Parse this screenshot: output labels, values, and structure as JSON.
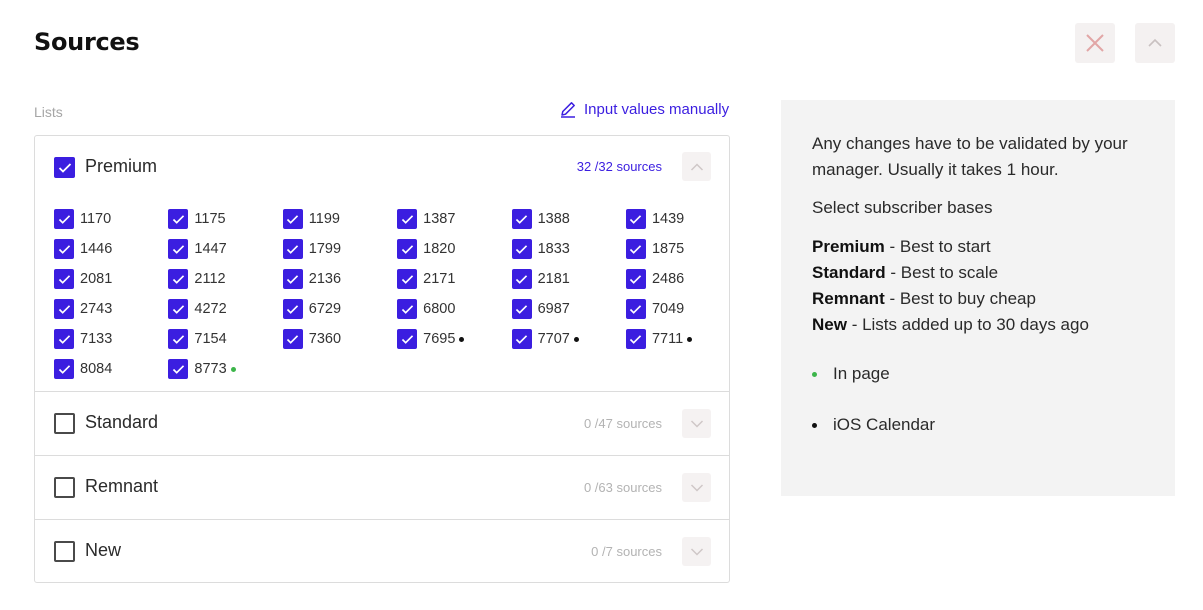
{
  "header": {
    "title": "Sources",
    "close_icon": "close-icon",
    "collapse_icon": "chevron-up-icon"
  },
  "lists_label": "Lists",
  "manual_link": {
    "label": "Input values manually",
    "icon": "pencil-icon"
  },
  "groups": [
    {
      "name": "Premium",
      "checked": true,
      "expanded": true,
      "count": "32 /32",
      "sources_word": "sources",
      "count_full": "32 /32  sources"
    },
    {
      "name": "Standard",
      "checked": false,
      "expanded": false,
      "count_full": "0 /47 sources"
    },
    {
      "name": "Remnant",
      "checked": false,
      "expanded": false,
      "count_full": "0 /63 sources"
    },
    {
      "name": "New",
      "checked": false,
      "expanded": false,
      "count_full": "0 /7 sources"
    }
  ],
  "premium_items": [
    {
      "label": "1170",
      "dot": null
    },
    {
      "label": "1175",
      "dot": null
    },
    {
      "label": "1199",
      "dot": null
    },
    {
      "label": "1387",
      "dot": null
    },
    {
      "label": "1388",
      "dot": null
    },
    {
      "label": "1439",
      "dot": null
    },
    {
      "label": "1446",
      "dot": null
    },
    {
      "label": "1447",
      "dot": null
    },
    {
      "label": "1799",
      "dot": null
    },
    {
      "label": "1820",
      "dot": null
    },
    {
      "label": "1833",
      "dot": null
    },
    {
      "label": "1875",
      "dot": null
    },
    {
      "label": "2081",
      "dot": null
    },
    {
      "label": "2112",
      "dot": null
    },
    {
      "label": "2136",
      "dot": null
    },
    {
      "label": "2171",
      "dot": null
    },
    {
      "label": "2181",
      "dot": null
    },
    {
      "label": "2486",
      "dot": null
    },
    {
      "label": "2743",
      "dot": null
    },
    {
      "label": "4272",
      "dot": null
    },
    {
      "label": "6729",
      "dot": null
    },
    {
      "label": "6800",
      "dot": null
    },
    {
      "label": "6987",
      "dot": null
    },
    {
      "label": "7049",
      "dot": null
    },
    {
      "label": "7133",
      "dot": null
    },
    {
      "label": "7154",
      "dot": null
    },
    {
      "label": "7360",
      "dot": null
    },
    {
      "label": "7695",
      "dot": "#111111"
    },
    {
      "label": "7707",
      "dot": "#111111"
    },
    {
      "label": "7711",
      "dot": "#111111"
    },
    {
      "label": "8084",
      "dot": null
    },
    {
      "label": "8773",
      "dot": "#3cb54a"
    }
  ],
  "info": {
    "intro": "Any changes have to be validated by your manager. Usually it takes 1 hour.",
    "select_heading": "Select subscriber bases",
    "bases": [
      {
        "name": "Premium",
        "desc": " - Best to start"
      },
      {
        "name": "Standard",
        "desc": " - Best to scale"
      },
      {
        "name": "Remnant",
        "desc": " - Best to buy cheap"
      },
      {
        "name": "New",
        "desc": " - Lists added up to 30 days ago"
      }
    ],
    "legend": [
      {
        "label": "In page",
        "color": "#3cb54a"
      },
      {
        "label": "iOS Calendar",
        "color": "#111111"
      }
    ]
  },
  "colors": {
    "accent": "#3b1ee0",
    "green": "#3cb54a",
    "panel": "#f3f3f3"
  }
}
